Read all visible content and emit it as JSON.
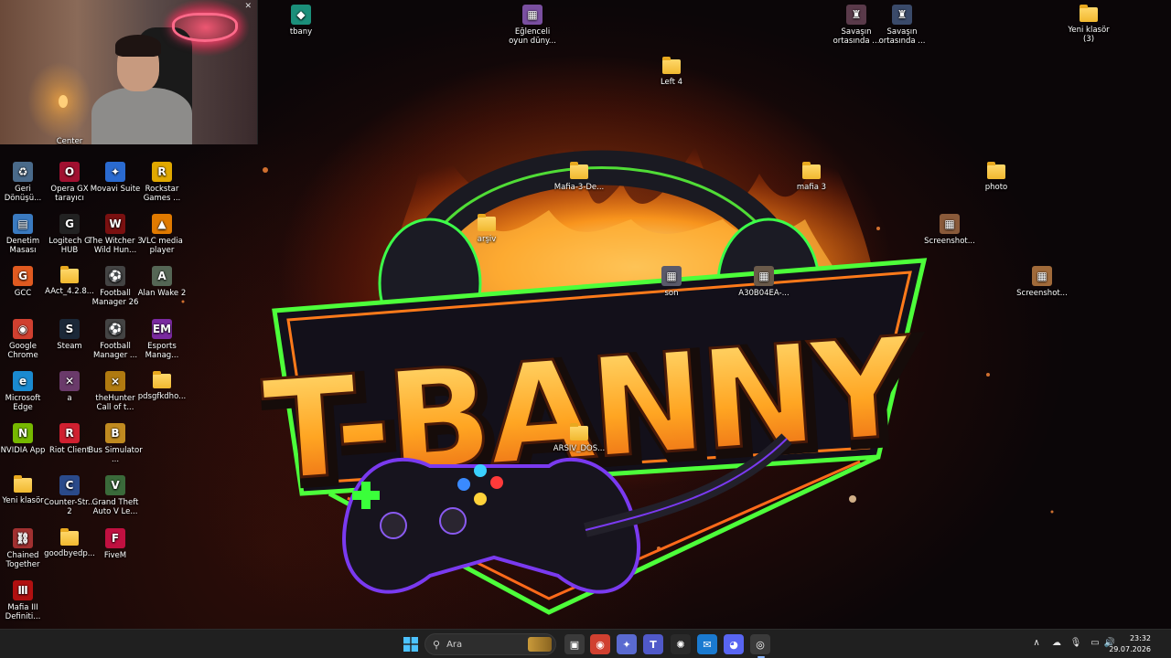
{
  "wallpaper": {
    "logo_text": "T-BANNY"
  },
  "webcam": {
    "partial_label": "Center"
  },
  "desktop_icons": [
    {
      "id": "tbany",
      "label": "tbany",
      "type": "app",
      "color": "#1b8f7a",
      "glyph": "◆"
    },
    {
      "id": "eglenceli",
      "label": "Eğlenceli oyun düny...",
      "type": "image",
      "color": "#7a4fa0",
      "glyph": "▦"
    },
    {
      "id": "left4",
      "label": "Left 4",
      "type": "folder"
    },
    {
      "id": "savasin1",
      "label": "Savaşın ortasında ...",
      "type": "app",
      "color": "#5a3a4a",
      "glyph": "♜"
    },
    {
      "id": "savasin2",
      "label": "Savaşın ortasında ...",
      "type": "app",
      "color": "#3a4a6a",
      "glyph": "♜"
    },
    {
      "id": "yeni3",
      "label": "Yeni klasör (3)",
      "type": "folder"
    },
    {
      "id": "geri",
      "label": "Geri Dönüşü...",
      "type": "app",
      "color": "#4a6a8a",
      "glyph": "♻"
    },
    {
      "id": "opera",
      "label": "Opera GX tarayıcı",
      "type": "app",
      "color": "#a01030",
      "glyph": "O"
    },
    {
      "id": "movavi",
      "label": "Movavi Suite",
      "type": "app",
      "color": "#2a6ad0",
      "glyph": "✦"
    },
    {
      "id": "rockstar",
      "label": "Rockstar Games ...",
      "type": "app",
      "color": "#e0a800",
      "glyph": "R"
    },
    {
      "id": "denetim",
      "label": "Denetim Masası",
      "type": "app",
      "color": "#3a7ac0",
      "glyph": "▤"
    },
    {
      "id": "logitech",
      "label": "Logitech G HUB",
      "type": "app",
      "color": "#222222",
      "glyph": "G"
    },
    {
      "id": "witcher",
      "label": "The Witcher 3 Wild Hun...",
      "type": "app",
      "color": "#7a1010",
      "glyph": "W"
    },
    {
      "id": "vlc",
      "label": "VLC media player",
      "type": "app",
      "color": "#e07a00",
      "glyph": "▲"
    },
    {
      "id": "gcc",
      "label": "GCC",
      "type": "app",
      "color": "#e05a20",
      "glyph": "G"
    },
    {
      "id": "aact",
      "label": "AAct_4.2.8...",
      "type": "folder"
    },
    {
      "id": "fm26",
      "label": "Football Manager 26",
      "type": "app",
      "color": "#444444",
      "glyph": "⚽"
    },
    {
      "id": "alanwake",
      "label": "Alan Wake 2",
      "type": "app",
      "color": "#556655",
      "glyph": "A"
    },
    {
      "id": "chrome",
      "label": "Google Chrome",
      "type": "app",
      "color": "#d04030",
      "glyph": "◉"
    },
    {
      "id": "steam",
      "label": "Steam",
      "type": "app",
      "color": "#1b2838",
      "glyph": "S"
    },
    {
      "id": "fm",
      "label": "Football Manager ...",
      "type": "app",
      "color": "#444444",
      "glyph": "⚽"
    },
    {
      "id": "esports",
      "label": "Esports Manag...",
      "type": "app",
      "color": "#7a2aa0",
      "glyph": "EM"
    },
    {
      "id": "edge",
      "label": "Microsoft Edge",
      "type": "app",
      "color": "#1a8ad0",
      "glyph": "e"
    },
    {
      "id": "a",
      "label": "a",
      "type": "app",
      "color": "#6a3a6a",
      "glyph": "✕"
    },
    {
      "id": "thehunter",
      "label": "theHunter Call of t...",
      "type": "app",
      "color": "#b07a10",
      "glyph": "⨯"
    },
    {
      "id": "pdsg",
      "label": "pdsgfkdho...",
      "type": "folder"
    },
    {
      "id": "nvidia",
      "label": "NVIDIA App",
      "type": "app",
      "color": "#76b900",
      "glyph": "N"
    },
    {
      "id": "riot",
      "label": "Riot Client",
      "type": "app",
      "color": "#d02030",
      "glyph": "R"
    },
    {
      "id": "bus",
      "label": "Bus Simulator ...",
      "type": "app",
      "color": "#c08a20",
      "glyph": "B"
    },
    {
      "id": "yeni",
      "label": "Yeni klasör",
      "type": "folder"
    },
    {
      "id": "cs2",
      "label": "Counter-Str... 2",
      "type": "app",
      "color": "#2a4a8a",
      "glyph": "C"
    },
    {
      "id": "gta",
      "label": "Grand Theft Auto V Le...",
      "type": "app",
      "color": "#3a6a3a",
      "glyph": "V"
    },
    {
      "id": "chained",
      "label": "Chained Together",
      "type": "app",
      "color": "#a03030",
      "glyph": "⛓"
    },
    {
      "id": "goodbye",
      "label": "goodbyedp...",
      "type": "folder"
    },
    {
      "id": "fivem",
      "label": "FiveM",
      "type": "app",
      "color": "#c01040",
      "glyph": "F"
    },
    {
      "id": "mafia3def",
      "label": "Mafia III Definiti...",
      "type": "app",
      "color": "#b01010",
      "glyph": "Ⅲ"
    },
    {
      "id": "mafia3de",
      "label": "Mafia-3-De...",
      "type": "folder"
    },
    {
      "id": "mafia3",
      "label": "mafia 3",
      "type": "folder"
    },
    {
      "id": "photo",
      "label": "photo",
      "type": "folder"
    },
    {
      "id": "arsiv",
      "label": "arşiv",
      "type": "folder"
    },
    {
      "id": "screenshot1",
      "label": "Screenshot...",
      "type": "image",
      "color": "#8a5a3a",
      "glyph": "▦"
    },
    {
      "id": "son",
      "label": "son",
      "type": "image",
      "color": "#5a5a6a",
      "glyph": "▦"
    },
    {
      "id": "a30b",
      "label": "A30B04EA-...",
      "type": "image",
      "color": "#6a5a4a",
      "glyph": "▦"
    },
    {
      "id": "screenshot2",
      "label": "Screenshot...",
      "type": "image",
      "color": "#a06a3a",
      "glyph": "▦"
    },
    {
      "id": "arsivdos",
      "label": "ARSIV_DOS...",
      "type": "folder"
    }
  ],
  "taskbar": {
    "search_placeholder": "Ara",
    "apps": [
      {
        "name": "task-view",
        "glyph": "▣",
        "color": "#3a3a3a"
      },
      {
        "name": "chrome",
        "glyph": "◉",
        "color": "#d04030"
      },
      {
        "name": "copilot",
        "glyph": "✦",
        "color": "#5a6ad0"
      },
      {
        "name": "teams",
        "glyph": "T",
        "color": "#5059c9"
      },
      {
        "name": "chatgpt",
        "glyph": "✺",
        "color": "#2a2a2a"
      },
      {
        "name": "mail",
        "glyph": "✉",
        "color": "#1a7ad0"
      },
      {
        "name": "discord",
        "glyph": "◕",
        "color": "#5865f2"
      },
      {
        "name": "obs",
        "glyph": "◎",
        "color": "#3a3a3a"
      }
    ],
    "tray": {
      "chevron": "∧",
      "time": "23:32",
      "date": "29.07.2026"
    }
  }
}
